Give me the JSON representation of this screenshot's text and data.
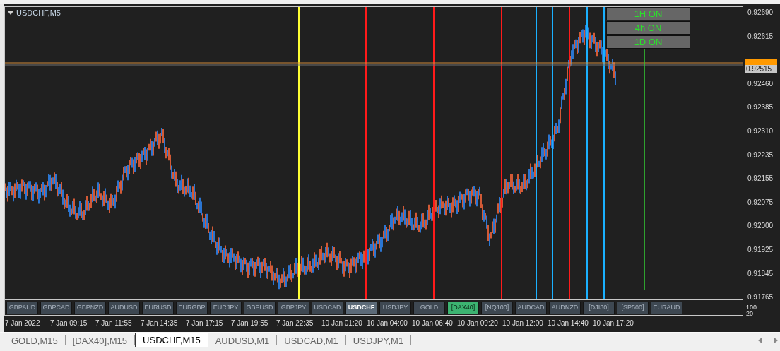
{
  "chart": {
    "title": "USDCHF,M5",
    "timeframe_buttons": [
      {
        "label": "1H ON"
      },
      {
        "label": "4h ON"
      },
      {
        "label": "1D ON"
      }
    ],
    "price_axis": [
      "0.92690",
      "0.92615",
      "0.92460",
      "0.92385",
      "0.92310",
      "0.92235",
      "0.92155",
      "0.92075",
      "0.92000",
      "0.91925",
      "0.91845",
      "0.91765"
    ],
    "current_price": "0.92515",
    "symbol_buttons": [
      {
        "label": "GBPAUD",
        "selected": false,
        "active": false
      },
      {
        "label": "GBPCAD",
        "selected": false,
        "active": false
      },
      {
        "label": "GBPNZD",
        "selected": false,
        "active": false
      },
      {
        "label": "AUDUSD",
        "selected": false,
        "active": false
      },
      {
        "label": "EURUSD",
        "selected": false,
        "active": false
      },
      {
        "label": "EURGBP",
        "selected": false,
        "active": false
      },
      {
        "label": "EURJPY",
        "selected": false,
        "active": false
      },
      {
        "label": "GBPUSD",
        "selected": false,
        "active": false
      },
      {
        "label": "GBPJPY",
        "selected": false,
        "active": false
      },
      {
        "label": "USDCAD",
        "selected": false,
        "active": false
      },
      {
        "label": "USDCHF",
        "selected": true,
        "active": false
      },
      {
        "label": "USDJPY",
        "selected": false,
        "active": false
      },
      {
        "label": "GOLD",
        "selected": false,
        "active": false
      },
      {
        "label": "[DAX40]",
        "selected": false,
        "active": true
      },
      {
        "label": "[NQ100]",
        "selected": false,
        "active": false
      },
      {
        "label": "AUDCAD",
        "selected": false,
        "active": false
      },
      {
        "label": "AUDNZD",
        "selected": false,
        "active": false
      },
      {
        "label": "[DJI30]",
        "selected": false,
        "active": false
      },
      {
        "label": "[SP500]",
        "selected": false,
        "active": false
      },
      {
        "label": "EURAUD",
        "selected": false,
        "active": false
      }
    ],
    "indicator_scale": [
      "100",
      "20"
    ],
    "time_axis": [
      "7 Jan 2022",
      "7 Jan 09:15",
      "7 Jan 11:55",
      "7 Jan 14:35",
      "7 Jan 17:15",
      "7 Jan 19:55",
      "7 Jan 22:35",
      "10 Jan 01:20",
      "10 Jan 04:00",
      "10 Jan 06:40",
      "10 Jan 09:20",
      "10 Jan 12:00",
      "10 Jan 14:40",
      "10 Jan 17:20"
    ]
  },
  "tabs": [
    {
      "label": "GOLD,M15",
      "selected": false
    },
    {
      "label": "[DAX40],M15",
      "selected": false
    },
    {
      "label": "USDCHF,M15",
      "selected": true
    },
    {
      "label": "AUDUSD,M1",
      "selected": false
    },
    {
      "label": "USDCAD,M1",
      "selected": false
    },
    {
      "label": "USDJPY,M1",
      "selected": false
    }
  ]
}
